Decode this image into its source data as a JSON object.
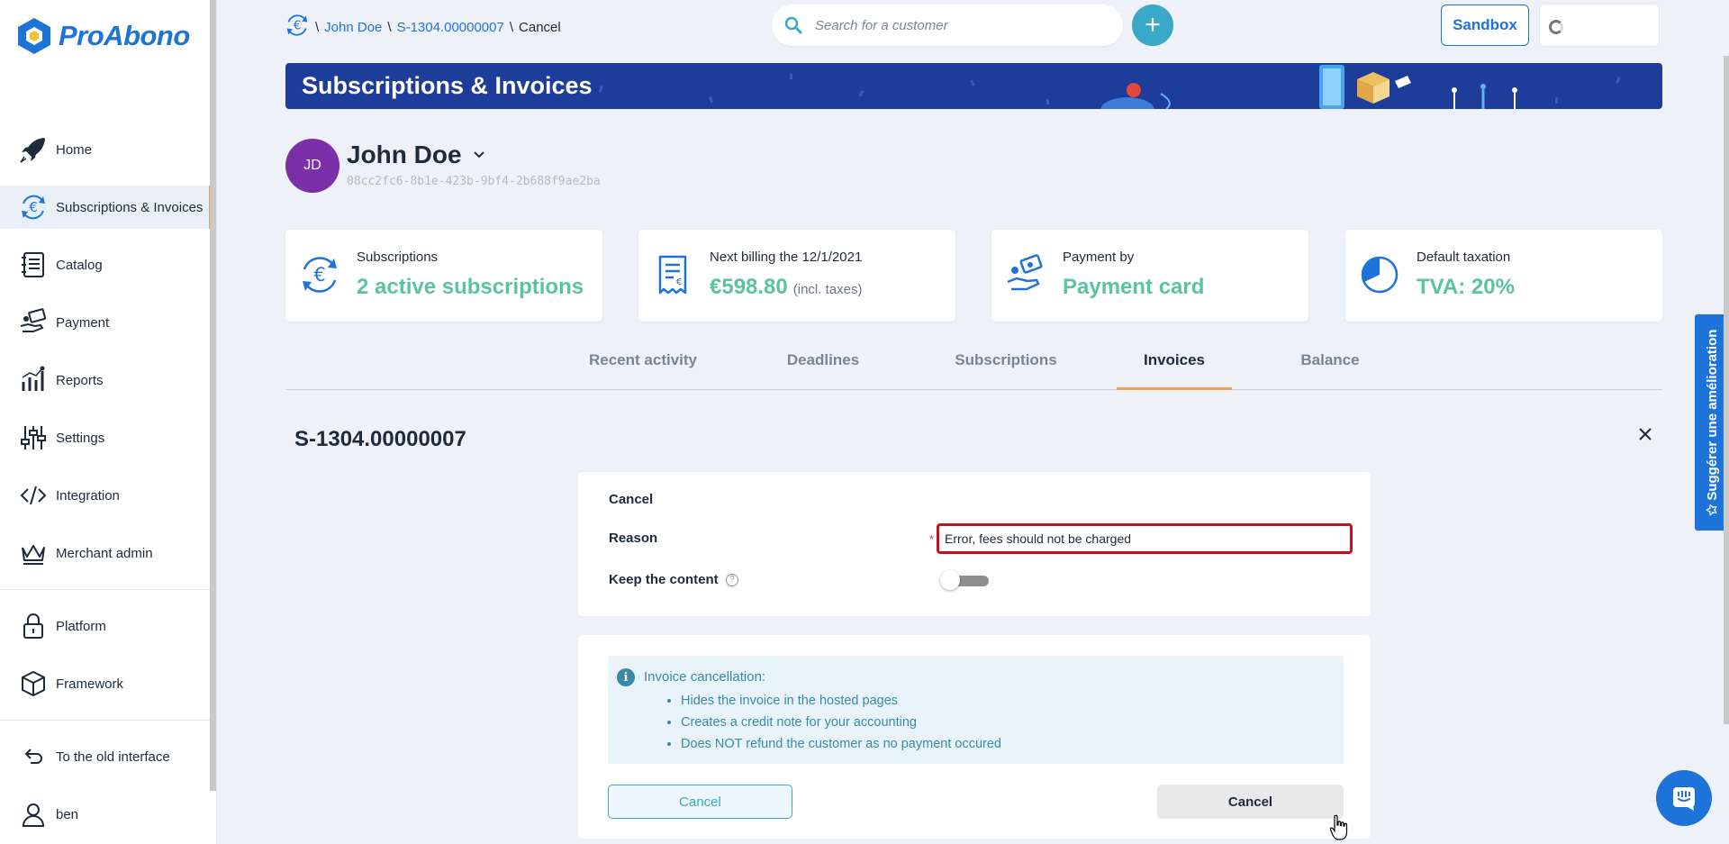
{
  "app": {
    "brand": "ProAbono"
  },
  "sidebar": {
    "items": [
      {
        "label": "Home",
        "icon": "rocket-icon"
      },
      {
        "label": "Subscriptions & Invoices",
        "icon": "euro-cycle-icon",
        "active": true
      },
      {
        "label": "Catalog",
        "icon": "catalog-icon"
      },
      {
        "label": "Payment",
        "icon": "payment-hand-icon"
      },
      {
        "label": "Reports",
        "icon": "reports-chart-icon"
      },
      {
        "label": "Settings",
        "icon": "sliders-icon"
      },
      {
        "label": "Integration",
        "icon": "code-icon"
      },
      {
        "label": "Merchant admin",
        "icon": "crown-icon"
      },
      {
        "label": "Platform",
        "icon": "lock-icon"
      },
      {
        "label": "Framework",
        "icon": "cube-icon"
      },
      {
        "label": "To the old interface",
        "icon": "undo-arrow-icon"
      },
      {
        "label": "ben",
        "icon": "user-icon"
      }
    ]
  },
  "breadcrumb": {
    "customer": "John Doe",
    "invoice": "S-1304.00000007",
    "current": "Cancel",
    "separator": "\\"
  },
  "search": {
    "placeholder": "Search for a customer",
    "value": ""
  },
  "topbar": {
    "add_label": "+",
    "sandbox_label": "Sandbox"
  },
  "banner": {
    "title": "Subscriptions & Invoices"
  },
  "customer": {
    "initials": "JD",
    "name": "John Doe",
    "id": "08cc2fc6-8b1e-423b-9bf4-2b688f9ae2ba"
  },
  "cards": {
    "subscriptions": {
      "label": "Subscriptions",
      "value": "2 active subscriptions"
    },
    "billing": {
      "label": "Next billing the 12/1/2021",
      "value": "€598.80",
      "suffix": "(incl. taxes)"
    },
    "payment": {
      "label": "Payment by",
      "value": "Payment card"
    },
    "taxation": {
      "label": "Default taxation",
      "value": "TVA: 20%"
    }
  },
  "tabs": [
    "Recent activity",
    "Deadlines",
    "Subscriptions",
    "Invoices",
    "Balance"
  ],
  "active_tab": "Invoices",
  "invoice": {
    "title": "S-1304.00000007"
  },
  "form": {
    "section_title": "Cancel",
    "reason_label": "Reason",
    "reason_required_mark": "*",
    "reason_value": "Error, fees should not be charged",
    "keep_content_label": "Keep the content",
    "help_mark": "?",
    "keep_content_on": false
  },
  "info": {
    "icon_glyph": "i",
    "heading": "Invoice cancellation:",
    "bullets": [
      "Hides the invoice in the hosted pages",
      "Creates a credit note for your accounting",
      "Does NOT refund the customer as no payment occured"
    ]
  },
  "actions": {
    "cancel_outline": "Cancel",
    "cancel_confirm": "Cancel"
  },
  "suggest": {
    "label": "Suggérer une amélioration"
  },
  "colors": {
    "brand_blue": "#1e73d8",
    "accent_orange": "#f0a152",
    "value_green": "#5ac3a0",
    "banner_navy": "#1e3c9a",
    "avatar_purple": "#7b2fa8",
    "error_red": "#c4111b",
    "info_teal": "#3a8aa6"
  }
}
